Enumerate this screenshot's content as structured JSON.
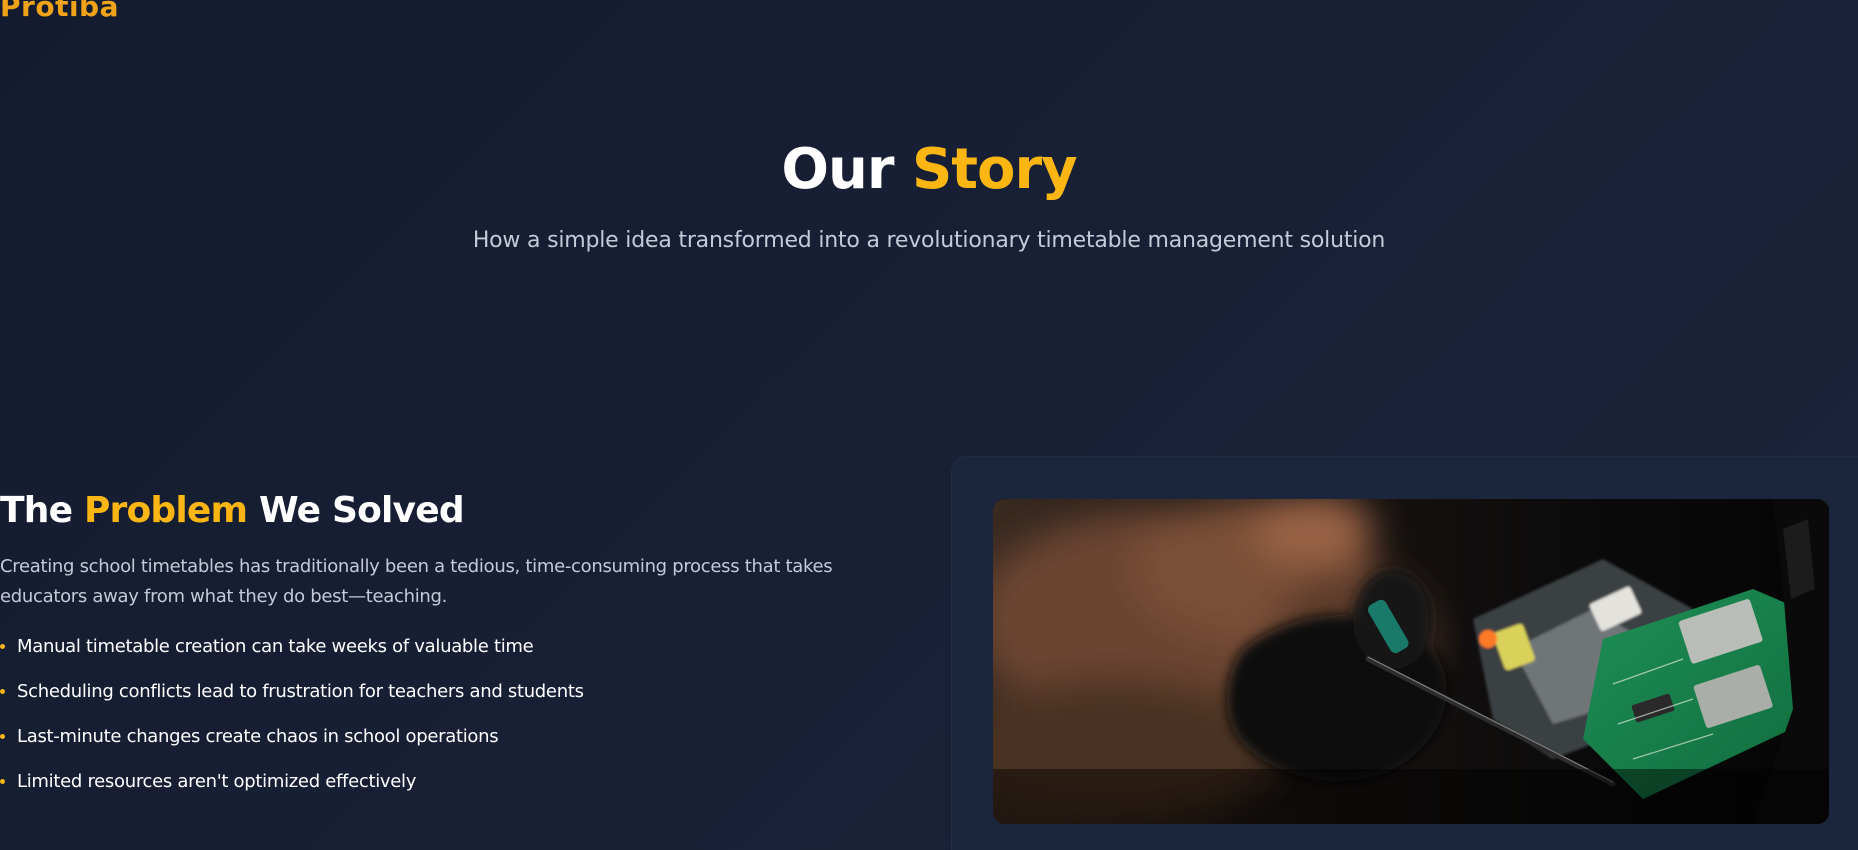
{
  "brand": {
    "name": "Protiba"
  },
  "hero": {
    "title_main": "Our",
    "title_accent": "Story",
    "subtitle": "How a simple idea transformed into a revolutionary timetable management solution"
  },
  "problem": {
    "title_before": "The",
    "title_accent": "Problem",
    "title_after": "We Solved",
    "description": "Creating school timetables has traditionally been a tedious, time-consuming process that takes educators away from what they do best—teaching.",
    "points": [
      "Manual timetable creation can take weeks of valuable time",
      "Scheduling conflicts lead to frustration for teachers and students",
      "Last-minute changes create chaos in school operations",
      "Limited resources aren't optimized effectively"
    ]
  },
  "image": {
    "subject": "hands repairing electronic circuit board"
  },
  "colors": {
    "background": "#171f33",
    "accent": "#fbb614",
    "logo": "#f0a318",
    "text": "#ffffff",
    "muted_text": "#c4cad8",
    "card": "#1b253b"
  }
}
